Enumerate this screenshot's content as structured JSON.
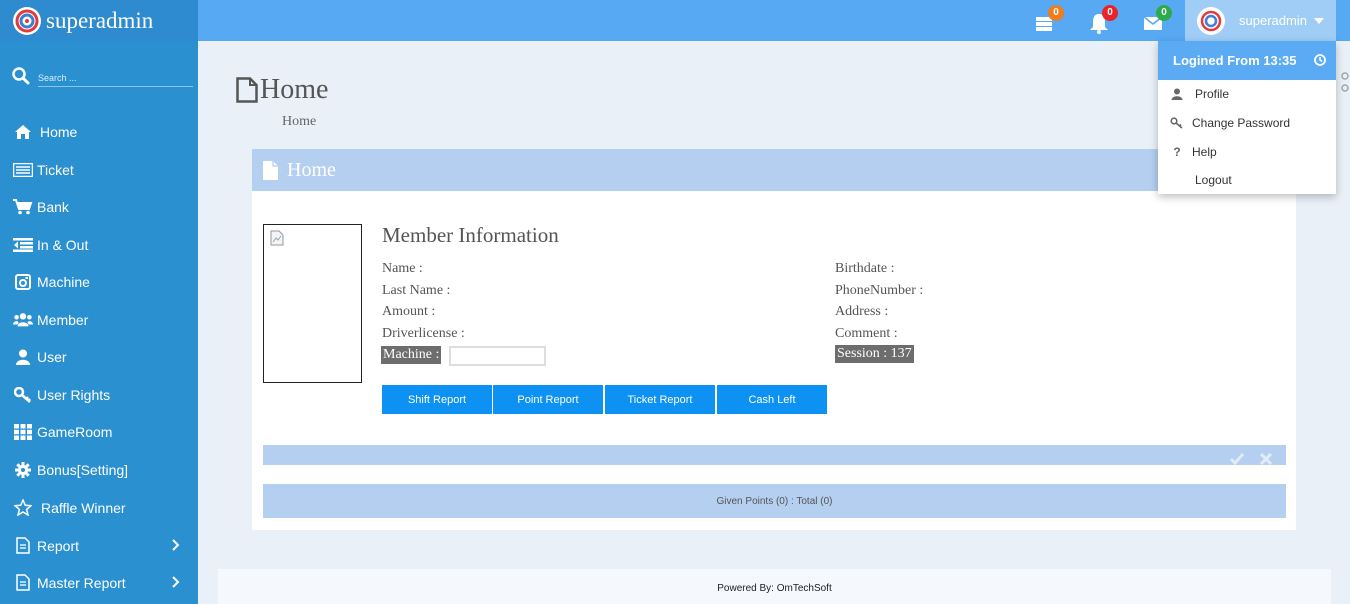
{
  "header": {
    "brand": "superadmin",
    "notifications": [
      {
        "name": "tasks",
        "count": "0",
        "color": "#f07c20"
      },
      {
        "name": "alerts",
        "count": "0",
        "color": "#e8232a"
      },
      {
        "name": "messages",
        "count": "0",
        "color": "#2daa4a"
      }
    ],
    "user": "superadmin"
  },
  "sidebar": {
    "search_placeholder": "Search ...",
    "items": [
      {
        "label": "Home",
        "icon": "home-icon"
      },
      {
        "label": "Ticket",
        "icon": "ticket-icon"
      },
      {
        "label": "Bank",
        "icon": "cart-icon"
      },
      {
        "label": "In & Out",
        "icon": "in-out-icon"
      },
      {
        "label": "Machine",
        "icon": "machine-icon"
      },
      {
        "label": "Member",
        "icon": "members-icon"
      },
      {
        "label": "User",
        "icon": "user-icon"
      },
      {
        "label": "User Rights",
        "icon": "key-icon"
      },
      {
        "label": "GameRoom",
        "icon": "grid-icon"
      },
      {
        "label": "Bonus[Setting]",
        "icon": "gear-icon"
      },
      {
        "label": "Raffle Winner",
        "icon": "star-icon"
      },
      {
        "label": "Report",
        "icon": "file-icon"
      },
      {
        "label": "Master Report",
        "icon": "file-icon"
      }
    ]
  },
  "page": {
    "title": "Home",
    "breadcrumb": "Home",
    "panel_title": "Home"
  },
  "member": {
    "title": "Member Information",
    "name_label": "Name :",
    "lastname_label": "Last Name :",
    "amount_label": "Amount :",
    "driverlicense_label": "Driverlicense :",
    "machine_label": "Machine :",
    "birthdate_label": "Birthdate :",
    "phone_label": "PhoneNumber :",
    "address_label": "Address :",
    "comment_label": "Comment :",
    "session_label": "Session : 137"
  },
  "buttons": {
    "shift_report": "Shift Report",
    "point_report": "Point Report",
    "ticket_report": "Ticket Report",
    "cash_left": "Cash Left"
  },
  "points_summary": "Given Points (0) : Total (0)",
  "footer": "Powered By: OmTechSoft",
  "dropdown": {
    "header": "Logined From 13:35",
    "items": [
      "Profile",
      "Change Password",
      "Help",
      "Logout"
    ]
  }
}
